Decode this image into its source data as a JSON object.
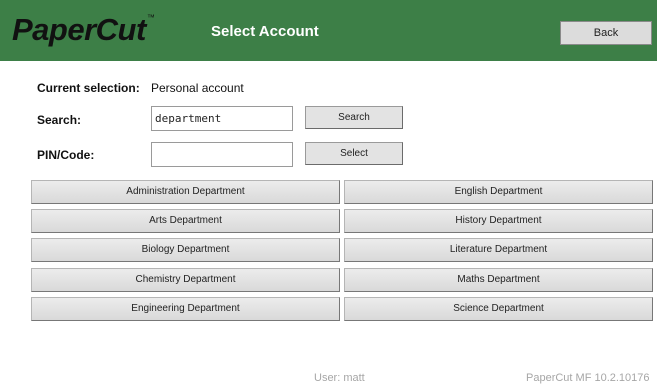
{
  "header": {
    "logo": "PaperCut",
    "logo_tm": "™",
    "title": "Select Account",
    "back_label": "Back"
  },
  "current_selection": {
    "label": "Current selection:",
    "value": "Personal account"
  },
  "search": {
    "label": "Search:",
    "value": "department",
    "button_label": "Search"
  },
  "pin": {
    "label": "PIN/Code:",
    "value": "",
    "button_label": "Select"
  },
  "accounts": [
    "Administration Department",
    "English Department",
    "Arts Department",
    "History Department",
    "Biology Department",
    "Literature Department",
    "Chemistry Department",
    "Maths Department",
    "Engineering Department",
    "Science Department"
  ],
  "footer": {
    "user": "User: matt",
    "version": "PaperCut MF 10.2.10176"
  },
  "colors": {
    "header_bg": "#3d7f47",
    "title_text": "#ffffff"
  }
}
